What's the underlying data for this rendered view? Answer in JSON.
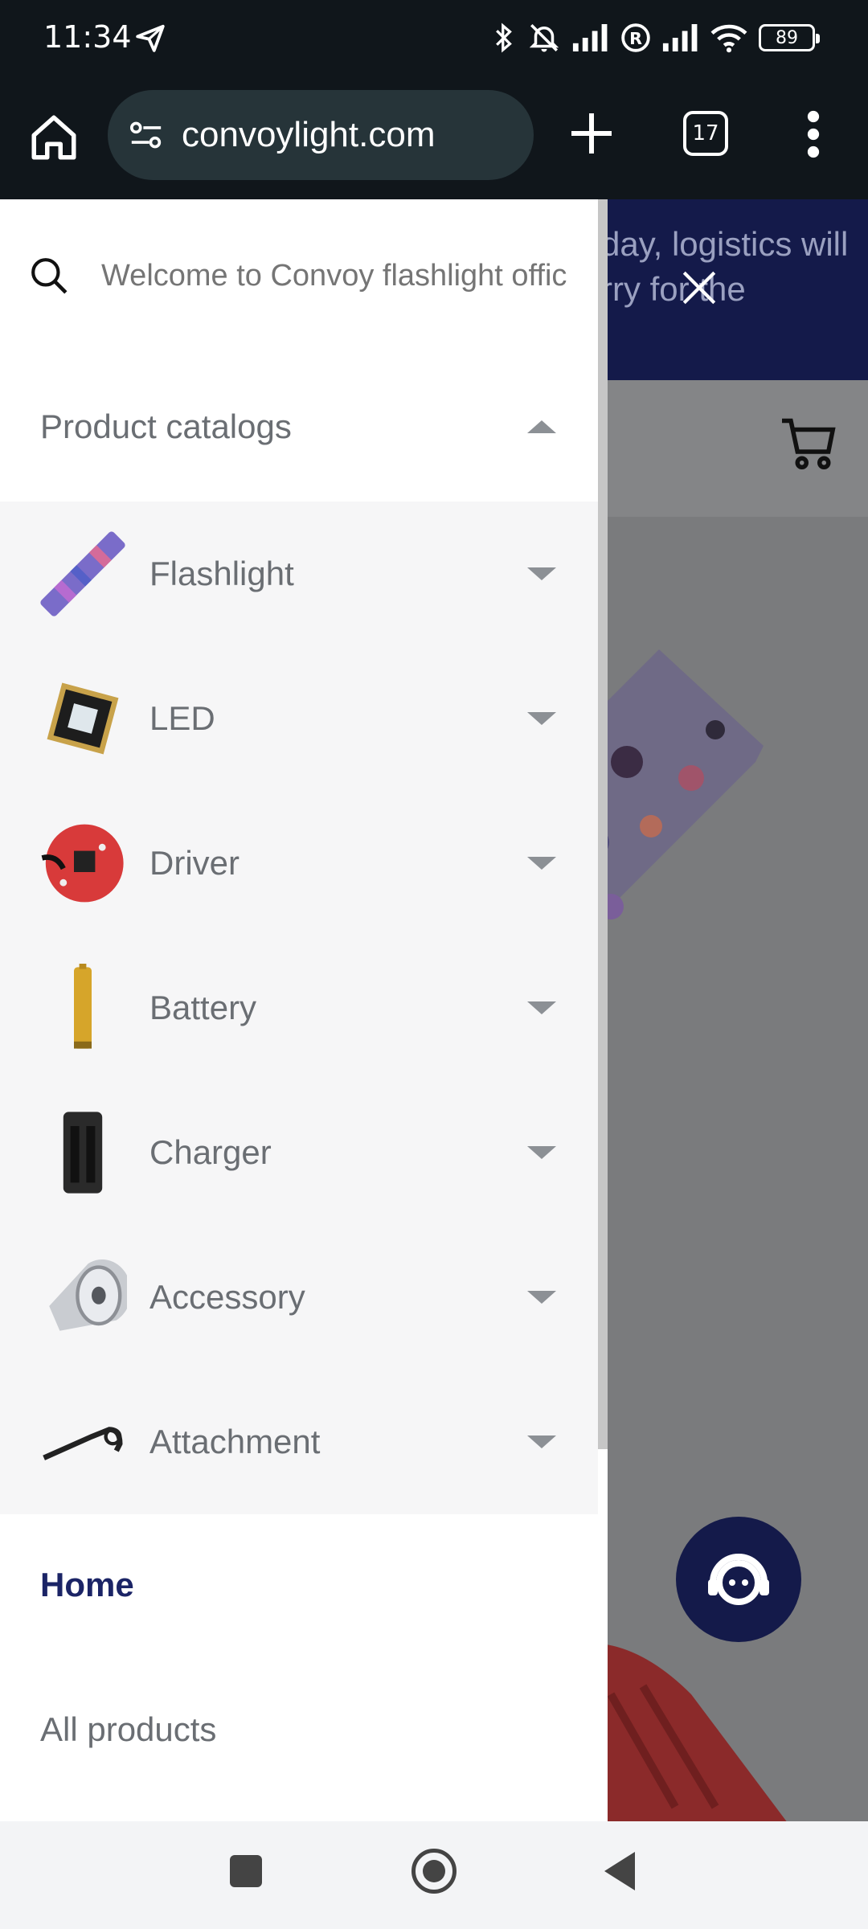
{
  "status_bar": {
    "time": "11:34",
    "battery": "89",
    "icons": [
      "send-icon",
      "bluetooth-icon",
      "mute-icon",
      "signal-icon",
      "registered-icon",
      "signal-icon",
      "wifi-icon",
      "battery-icon"
    ]
  },
  "browser": {
    "url": "convoylight.com",
    "tab_count": "17",
    "icons": [
      "home-icon",
      "site-settings-icon",
      "plus-icon",
      "tabs-icon",
      "more-vert-icon"
    ]
  },
  "background_page": {
    "banner_text_line1": "day, logistics will",
    "banner_text_line2": "rry for the",
    "colors": {
      "banner": "#141a4a",
      "overlay": "#7a7b7d"
    }
  },
  "drawer": {
    "search": {
      "placeholder": "Welcome to Convoy flashlight offic"
    },
    "catalog_header": "Product catalogs",
    "categories": [
      {
        "label": "Flashlight",
        "thumb": "flashlight-thumb"
      },
      {
        "label": "LED",
        "thumb": "led-thumb"
      },
      {
        "label": "Driver",
        "thumb": "driver-thumb"
      },
      {
        "label": "Battery",
        "thumb": "battery-thumb"
      },
      {
        "label": "Charger",
        "thumb": "charger-thumb"
      },
      {
        "label": "Accessory",
        "thumb": "accessory-thumb"
      },
      {
        "label": "Attachment",
        "thumb": "attachment-thumb"
      }
    ],
    "nav": {
      "home": "Home",
      "all_products": "All products"
    },
    "colors": {
      "active": "#1b2466",
      "text": "#6a6e73",
      "list_bg": "#f6f6f7"
    }
  }
}
